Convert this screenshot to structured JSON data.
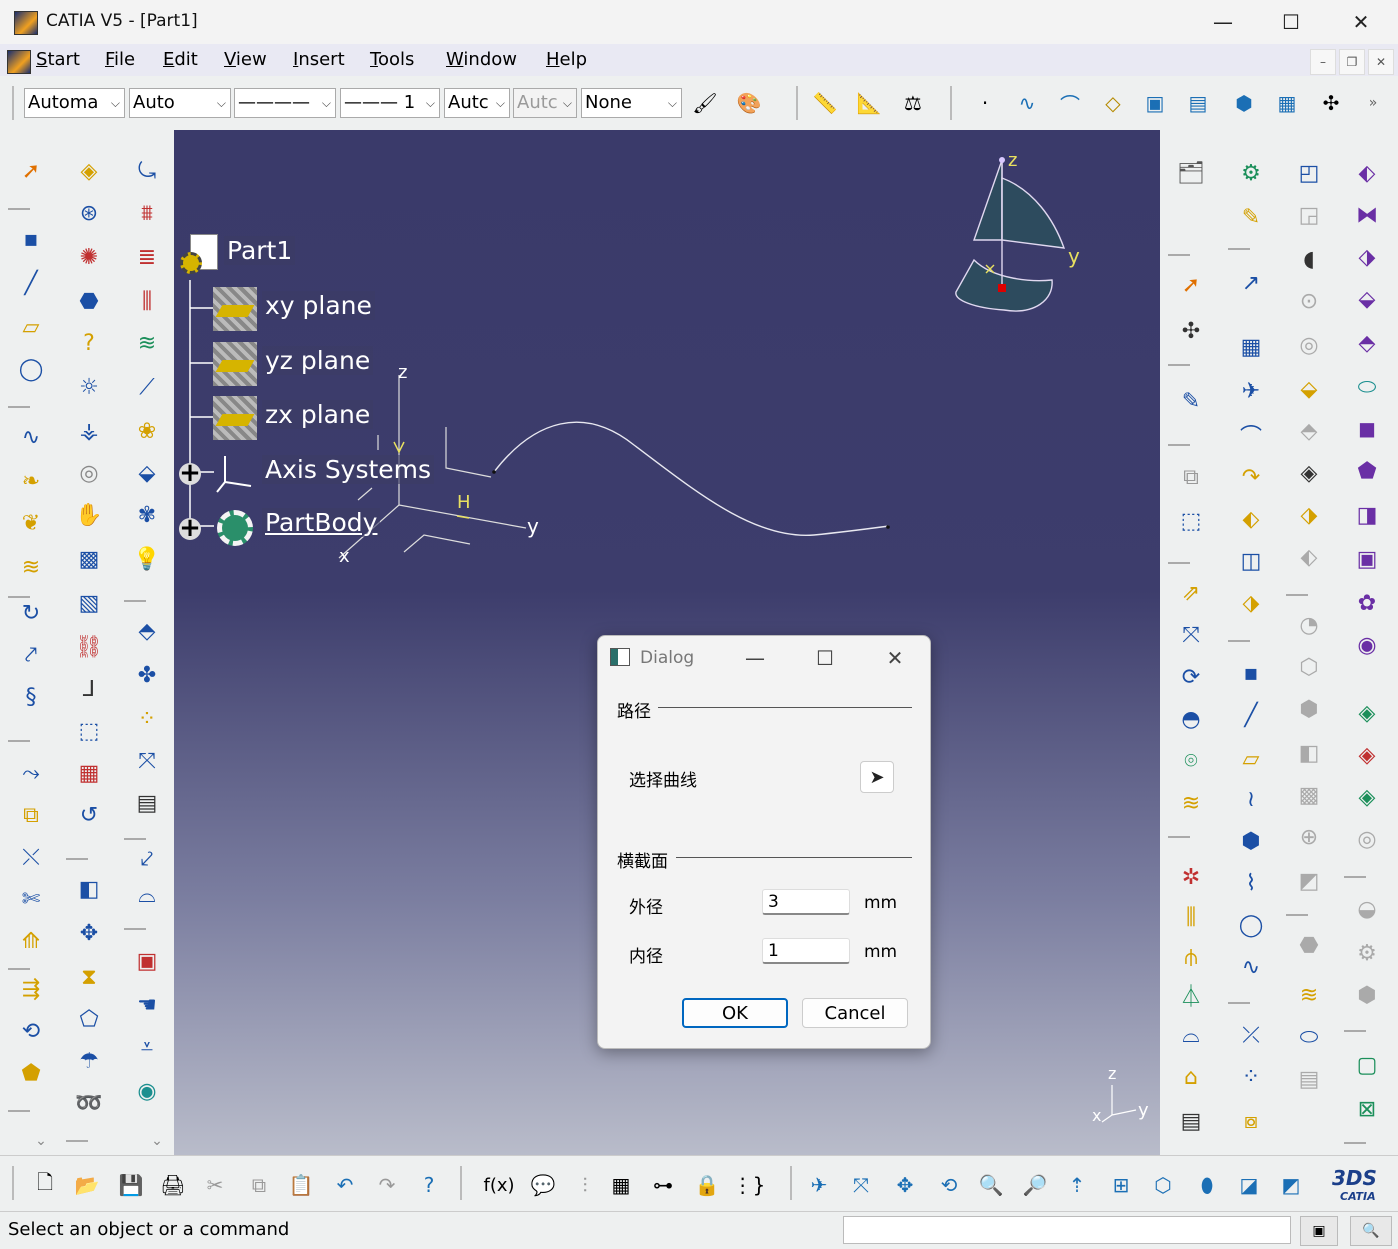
{
  "window": {
    "title": "CATIA V5 - [Part1]",
    "minimize": "—",
    "maximize": "☐",
    "close": "✕"
  },
  "menubar": {
    "start": "Start",
    "items": [
      "File",
      "Edit",
      "View",
      "Insert",
      "Tools",
      "Window",
      "Help"
    ]
  },
  "properties_toolbar": {
    "color": "Automa",
    "transparency": "Auto",
    "linetype": "————",
    "linewidth_text": "——— 1",
    "layer": "Autc",
    "render_disabled": "Autc",
    "style": "None"
  },
  "tree": {
    "root": "Part1",
    "nodes": [
      "xy plane",
      "yz plane",
      "zx plane",
      "Axis Systems",
      "PartBody"
    ]
  },
  "compass": {
    "z": "z",
    "y": "y",
    "x": "x"
  },
  "origin_axes": {
    "z": "z",
    "y": "y",
    "x": "x",
    "h": "H"
  },
  "mini_axes": {
    "z": "z",
    "y": "y",
    "x": "x"
  },
  "dialog": {
    "title": "Dialog",
    "group_path": "路径",
    "select_curve_label": "选择曲线",
    "group_section": "横截面",
    "outer_label": "外径",
    "outer_value": "3",
    "outer_unit": "mm",
    "inner_label": "内径",
    "inner_value": "1",
    "inner_unit": "mm",
    "ok": "OK",
    "cancel": "Cancel"
  },
  "statusbar": {
    "message": "Select an object or a command"
  },
  "bottom_toolbar": {
    "formula_label": "f(x)",
    "brand": "CATIA"
  },
  "colors": {
    "accent": "#0067c0",
    "viewport_top": "#3a3a6a",
    "viewport_bottom": "#b9bcca"
  }
}
